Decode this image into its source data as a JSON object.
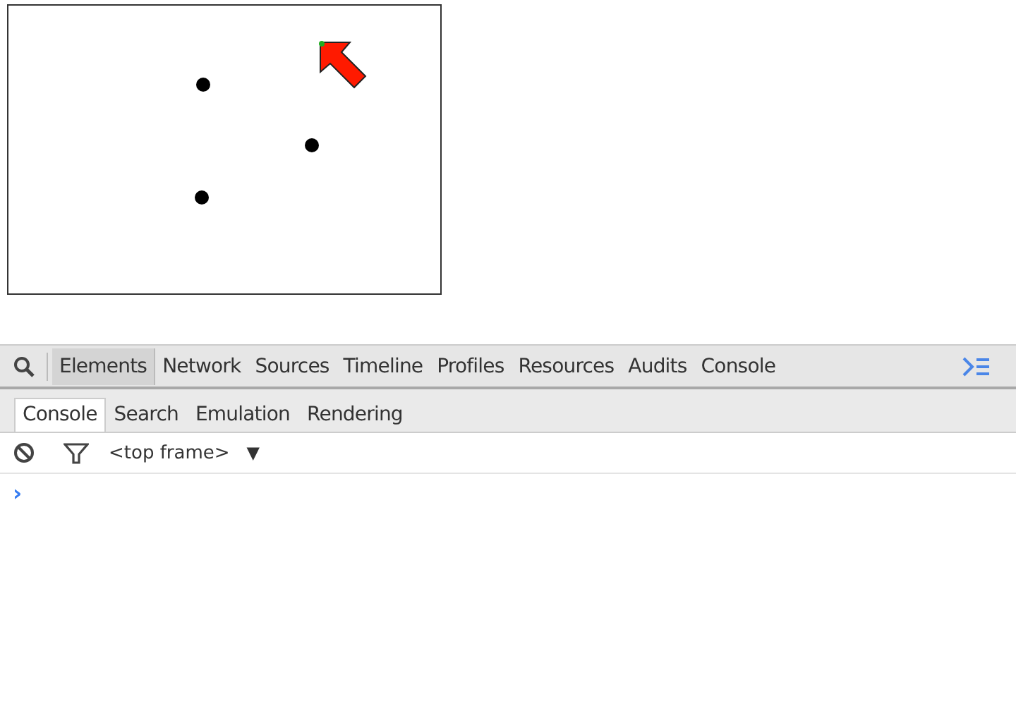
{
  "panels": [
    {
      "label": "Elements",
      "selected": true
    },
    {
      "label": "Network",
      "selected": false
    },
    {
      "label": "Sources",
      "selected": false
    },
    {
      "label": "Timeline",
      "selected": false
    },
    {
      "label": "Profiles",
      "selected": false
    },
    {
      "label": "Resources",
      "selected": false
    },
    {
      "label": "Audits",
      "selected": false
    },
    {
      "label": "Console",
      "selected": false
    }
  ],
  "drawer_tabs": [
    {
      "label": "Console",
      "selected": true
    },
    {
      "label": "Search",
      "selected": false
    },
    {
      "label": "Emulation",
      "selected": false
    },
    {
      "label": "Rendering",
      "selected": false
    }
  ],
  "console": {
    "frame": "<top frame>",
    "dropdown": "▼",
    "prompt": "›"
  }
}
